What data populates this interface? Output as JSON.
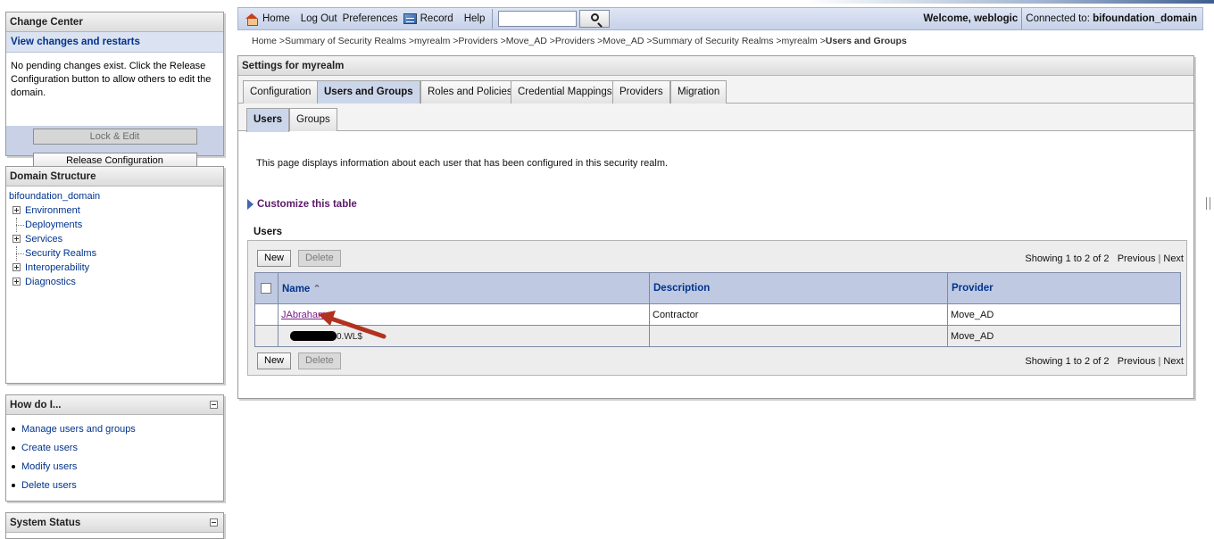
{
  "change_center": {
    "title": "Change Center",
    "subtitle": "View changes and restarts",
    "message": "No pending changes exist. Click the Release Configuration button to allow others to edit the domain.",
    "lock_edit": "Lock & Edit",
    "release": "Release Configuration"
  },
  "domain_structure": {
    "title": "Domain Structure",
    "root": "bifoundation_domain",
    "items": [
      {
        "label": "Environment",
        "expandable": true
      },
      {
        "label": "Deployments",
        "expandable": false
      },
      {
        "label": "Services",
        "expandable": true
      },
      {
        "label": "Security Realms",
        "expandable": false
      },
      {
        "label": "Interoperability",
        "expandable": true
      },
      {
        "label": "Diagnostics",
        "expandable": true
      }
    ]
  },
  "how_do_i": {
    "title": "How do I...",
    "items": [
      "Manage users and groups",
      "Create users",
      "Modify users",
      "Delete users"
    ]
  },
  "system_status": {
    "title": "System Status"
  },
  "topbar": {
    "home": "Home",
    "logout": "Log Out",
    "preferences": "Preferences",
    "record": "Record",
    "help": "Help",
    "search_value": "",
    "welcome": "Welcome, weblogic",
    "connected_label": "Connected to:",
    "connected_domain": "bifoundation_domain"
  },
  "breadcrumb": {
    "path": "Home >Summary of Security Realms >myrealm >Providers >Move_AD >Providers >Move_AD >Summary of Security Realms >myrealm >",
    "current": "Users and Groups"
  },
  "settings": {
    "title": "Settings for myrealm",
    "tabs": [
      "Configuration",
      "Users and Groups",
      "Roles and Policies",
      "Credential Mappings",
      "Providers",
      "Migration"
    ],
    "subtabs": [
      "Users",
      "Groups"
    ],
    "description": "This page displays information about each user that has been configured in this security realm.",
    "customize": "Customize this table",
    "table_title": "Users",
    "new_label": "New",
    "delete_label": "Delete",
    "showing": "Showing 1 to 2 of 2",
    "previous": "Previous",
    "next": "Next",
    "columns": [
      "Name",
      "Description",
      "Provider"
    ],
    "rows": [
      {
        "name": "JAbraham",
        "description": "Contractor",
        "provider": "Move_AD"
      },
      {
        "name": "0.WL$",
        "description": "",
        "provider": "Move_AD"
      }
    ]
  },
  "colors": {
    "accent": "#00338c",
    "visited_link": "#7a1a8a",
    "header_bg": "#bfcae2",
    "annotation_arrow": "#b2321f"
  }
}
